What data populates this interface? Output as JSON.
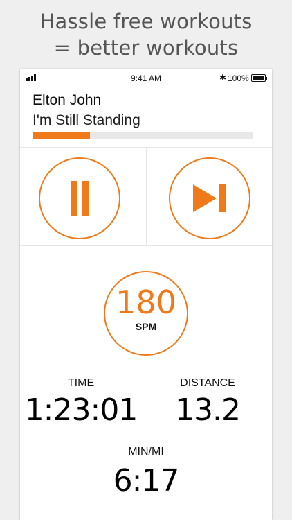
{
  "headline": {
    "line1": "Hassle free workouts",
    "line2": "= better workouts"
  },
  "status_bar": {
    "time": "9:41 AM",
    "battery_percent": "100%",
    "bluetooth_icon": "bluetooth-icon",
    "signal_icon": "signal-icon",
    "battery_icon": "battery-icon"
  },
  "now_playing": {
    "artist": "Elton John",
    "track": "I'm Still Standing",
    "progress_fraction": 0.26
  },
  "controls": {
    "pause_icon": "pause-icon",
    "skip_icon": "skip-next-icon"
  },
  "cadence": {
    "value": "180",
    "unit": "SPM"
  },
  "stats": {
    "time_label": "TIME",
    "time_value": "1:23:01",
    "distance_label": "DISTANCE",
    "distance_value": "13.2",
    "pace_label": "MIN/MI",
    "pace_value": "6:17"
  },
  "colors": {
    "accent": "#f07a1a",
    "text": "#111111",
    "headline": "#555555",
    "background": "#efefef"
  }
}
